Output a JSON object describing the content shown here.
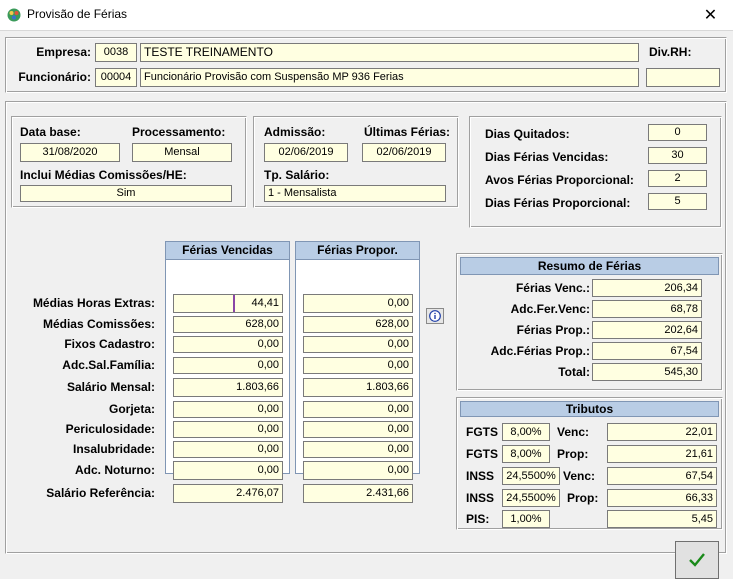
{
  "window": {
    "title": "Provisão de Férias",
    "close_glyph": "✕"
  },
  "header": {
    "empresa_label": "Empresa:",
    "empresa_code": "0038",
    "empresa_name": "TESTE TREINAMENTO",
    "divrh_label": "Div.RH:",
    "divrh_value": "",
    "funcionario_label": "Funcionário:",
    "funcionario_code": "00004",
    "funcionario_name": "Funcionário Provisão com Suspensão MP 936 Ferias"
  },
  "info1": {
    "data_base_label": "Data base:",
    "data_base_value": "31/08/2020",
    "processamento_label": "Processamento:",
    "processamento_value": "Mensal",
    "inclui_label": "Inclui Médias Comissões/HE:",
    "inclui_value": "Sim"
  },
  "info2": {
    "admissao_label": "Admissão:",
    "admissao_value": "02/06/2019",
    "ultimas_label": "Últimas Férias:",
    "ultimas_value": "02/06/2019",
    "tp_salario_label": "Tp. Salário:",
    "tp_salario_value": "1 - Mensalista"
  },
  "dias": [
    {
      "label": "Dias Quitados:",
      "value": "0"
    },
    {
      "label": "Dias Férias Vencidas:",
      "value": "30"
    },
    {
      "label": "Avos Férias Proporcional:",
      "value": "2"
    },
    {
      "label": "Dias Férias Proporcional:",
      "value": "5"
    }
  ],
  "grid": {
    "col_vencidas": "Férias Vencidas",
    "col_propor": "Férias Propor.",
    "rows": [
      {
        "label": "Médias Horas Extras:",
        "vencidas": "44,41",
        "propor": "0,00"
      },
      {
        "label": "Médias Comissões:",
        "vencidas": "628,00",
        "propor": "628,00"
      },
      {
        "label": "Fixos Cadastro:",
        "vencidas": "0,00",
        "propor": "0,00"
      },
      {
        "label": "Adc.Sal.Família:",
        "vencidas": "0,00",
        "propor": "0,00"
      },
      {
        "label": "Salário Mensal:",
        "vencidas": "1.803,66",
        "propor": "1.803,66"
      },
      {
        "label": "Gorjeta:",
        "vencidas": "0,00",
        "propor": "0,00"
      },
      {
        "label": "Periculosidade:",
        "vencidas": "0,00",
        "propor": "0,00"
      },
      {
        "label": "Insalubridade:",
        "vencidas": "0,00",
        "propor": "0,00"
      },
      {
        "label": "Adc. Noturno:",
        "vencidas": "0,00",
        "propor": "0,00"
      },
      {
        "label": "Salário Referência:",
        "vencidas": "2.476,07",
        "propor": "2.431,66"
      }
    ]
  },
  "resumo": {
    "title": "Resumo de Férias",
    "rows": [
      {
        "label": "Férias Venc.:",
        "value": "206,34"
      },
      {
        "label": "Adc.Fer.Venc:",
        "value": "68,78"
      },
      {
        "label": "Férias Prop.:",
        "value": "202,64"
      },
      {
        "label": "Adc.Férias Prop.:",
        "value": "67,54"
      },
      {
        "label": "Total:",
        "value": "545,30"
      }
    ]
  },
  "tributos": {
    "title": "Tributos",
    "rows": [
      {
        "label": "FGTS",
        "rate": "8,00%",
        "kind": "Venc:",
        "value": "22,01"
      },
      {
        "label": "FGTS",
        "rate": "8,00%",
        "kind": "Prop:",
        "value": "21,61"
      },
      {
        "label": "INSS",
        "rate": "24,5500%",
        "kind": "Venc:",
        "value": "67,54"
      },
      {
        "label": "INSS",
        "rate": "24,5500%",
        "kind": "Prop:",
        "value": "66,33"
      },
      {
        "label": "PIS:",
        "rate": "1,00%",
        "kind": "",
        "value": "5,45"
      }
    ]
  },
  "colors": {
    "field_bg": "#ffffe1",
    "header_bg": "#b9cde5",
    "check_green": "#1a8a1a",
    "focus": "#8a46a6"
  },
  "icons": {
    "app": "palette-icon",
    "info": "info-icon",
    "ok": "checkmark-icon",
    "close": "close-icon"
  }
}
